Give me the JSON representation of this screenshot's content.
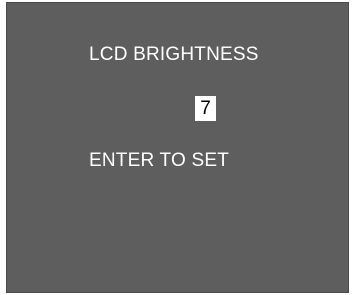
{
  "osd": {
    "title": "LCD BRIGHTNESS",
    "value": "7",
    "instruction": "ENTER TO SET"
  }
}
